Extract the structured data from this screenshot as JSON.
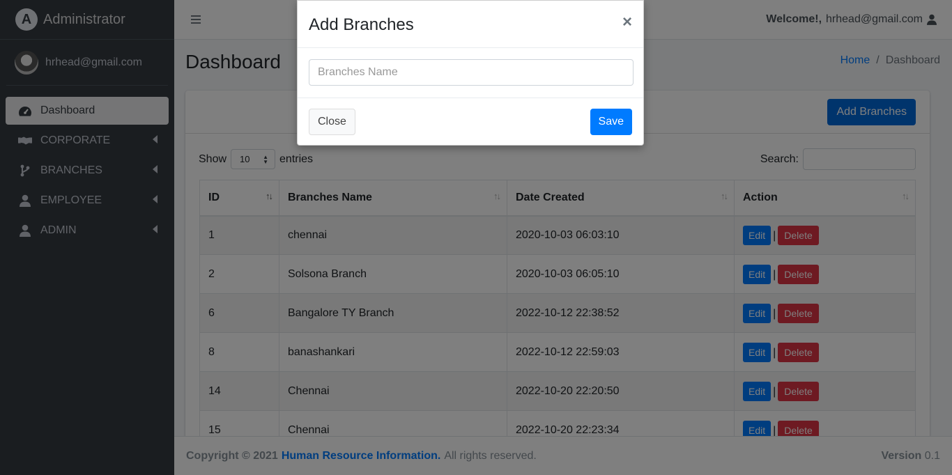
{
  "brand": {
    "title": "Administrator",
    "logo_letter": "A"
  },
  "user": {
    "name": "hrhead@gmail.com"
  },
  "sidebar": {
    "items": [
      {
        "label": "Dashboard",
        "icon": "tachometer-icon",
        "active": true
      },
      {
        "label": "CORPORATE",
        "icon": "handshake-icon"
      },
      {
        "label": "BRANCHES",
        "icon": "code-branch-icon"
      },
      {
        "label": "EMPLOYEE",
        "icon": "user-icon"
      },
      {
        "label": "ADMIN",
        "icon": "user-icon"
      }
    ]
  },
  "topbar": {
    "welcome_label": "Welcome!,",
    "welcome_user": "hrhead@gmail.com"
  },
  "page": {
    "title": "Dashboard"
  },
  "breadcrumb": {
    "home": "Home",
    "separator": "/",
    "current": "Dashboard"
  },
  "card": {
    "add_button": "Add Branches"
  },
  "table_controls": {
    "show_label": "Show",
    "page_length": "10",
    "entries_label": "entries",
    "search_label": "Search:",
    "search_value": ""
  },
  "table": {
    "columns": [
      "ID",
      "Branches Name",
      "Date Created",
      "Action"
    ],
    "edit_label": "Edit",
    "delete_label": "Delete",
    "pipe": "|",
    "rows": [
      {
        "id": "1",
        "name": "chennai",
        "date": "2020-10-03 06:03:10"
      },
      {
        "id": "2",
        "name": "Solsona Branch",
        "date": "2020-10-03 06:05:10"
      },
      {
        "id": "6",
        "name": "Bangalore TY Branch",
        "date": "2022-10-12 22:38:52"
      },
      {
        "id": "8",
        "name": "banashankari",
        "date": "2022-10-12 22:59:03"
      },
      {
        "id": "14",
        "name": "Chennai",
        "date": "2022-10-20 22:20:50"
      },
      {
        "id": "15",
        "name": "Chennai",
        "date": "2022-10-20 22:23:34"
      }
    ]
  },
  "footer": {
    "copyright": "Copyright © 2021",
    "link": "Human Resource Information.",
    "rights": "All rights reserved.",
    "version_label": "Version",
    "version_value": "0.1"
  },
  "modal": {
    "title": "Add Branches",
    "close_glyph": "×",
    "input_placeholder": "Branches Name",
    "input_value": "",
    "close_button": "Close",
    "save_button": "Save"
  },
  "colors": {
    "sidebar_bg": "#343a40",
    "primary": "#007bff",
    "danger": "#dc3545",
    "overlay": "rgba(0,0,0,0.5)"
  }
}
